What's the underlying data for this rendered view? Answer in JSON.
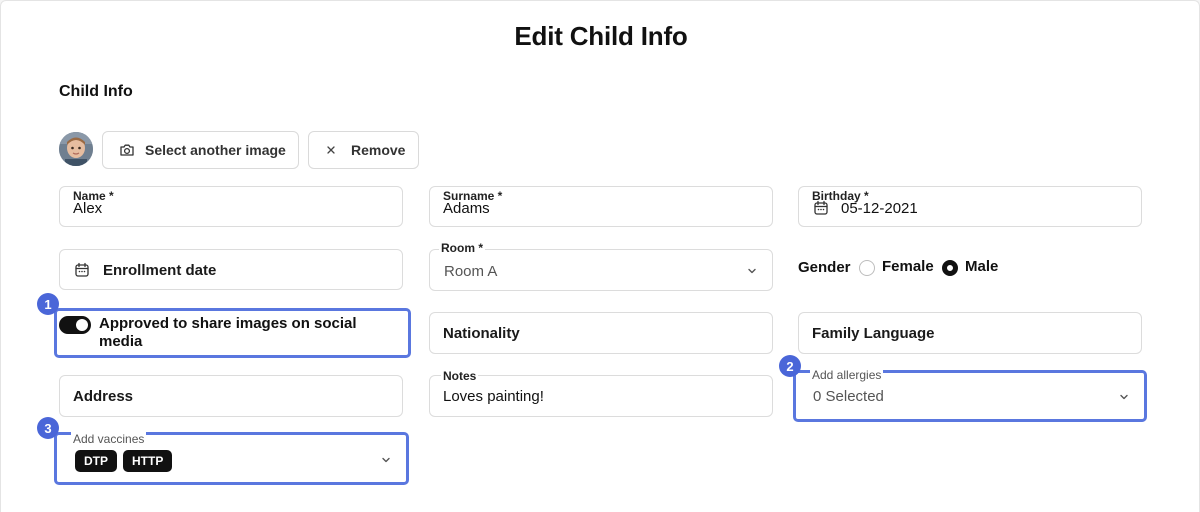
{
  "page": {
    "title": "Edit Child Info",
    "section_title": "Child Info"
  },
  "photo": {
    "select_label": "Select another image",
    "remove_label": "Remove"
  },
  "fields": {
    "name": {
      "label": "Name *",
      "value": "Alex"
    },
    "surname": {
      "label": "Surname *",
      "value": "Adams"
    },
    "birthday": {
      "label": "Birthday *",
      "value": "05-12-2021"
    },
    "enrollment": {
      "placeholder": "Enrollment date"
    },
    "room": {
      "label": "Room *",
      "value": "Room A"
    },
    "gender": {
      "label": "Gender",
      "options": [
        "Female",
        "Male"
      ],
      "selected": "Male"
    },
    "social": {
      "label": "Approved to share images on social media",
      "on": true
    },
    "nationality": {
      "placeholder": "Nationality"
    },
    "family_language": {
      "placeholder": "Family Language"
    },
    "address": {
      "placeholder": "Address"
    },
    "notes": {
      "label": "Notes",
      "value": "Loves painting!"
    },
    "allergies": {
      "label": "Add allergies",
      "value": "0 Selected"
    },
    "vaccines": {
      "label": "Add vaccines",
      "chips": [
        "DTP",
        "HTTP"
      ]
    }
  },
  "annotations": [
    "1",
    "2",
    "3"
  ],
  "colors": {
    "highlight": "#5a77df",
    "badge": "#4a66d8",
    "toggle": "#111111"
  },
  "icons": [
    "camera-icon",
    "close-icon",
    "calendar-icon",
    "chevron-down-icon"
  ]
}
